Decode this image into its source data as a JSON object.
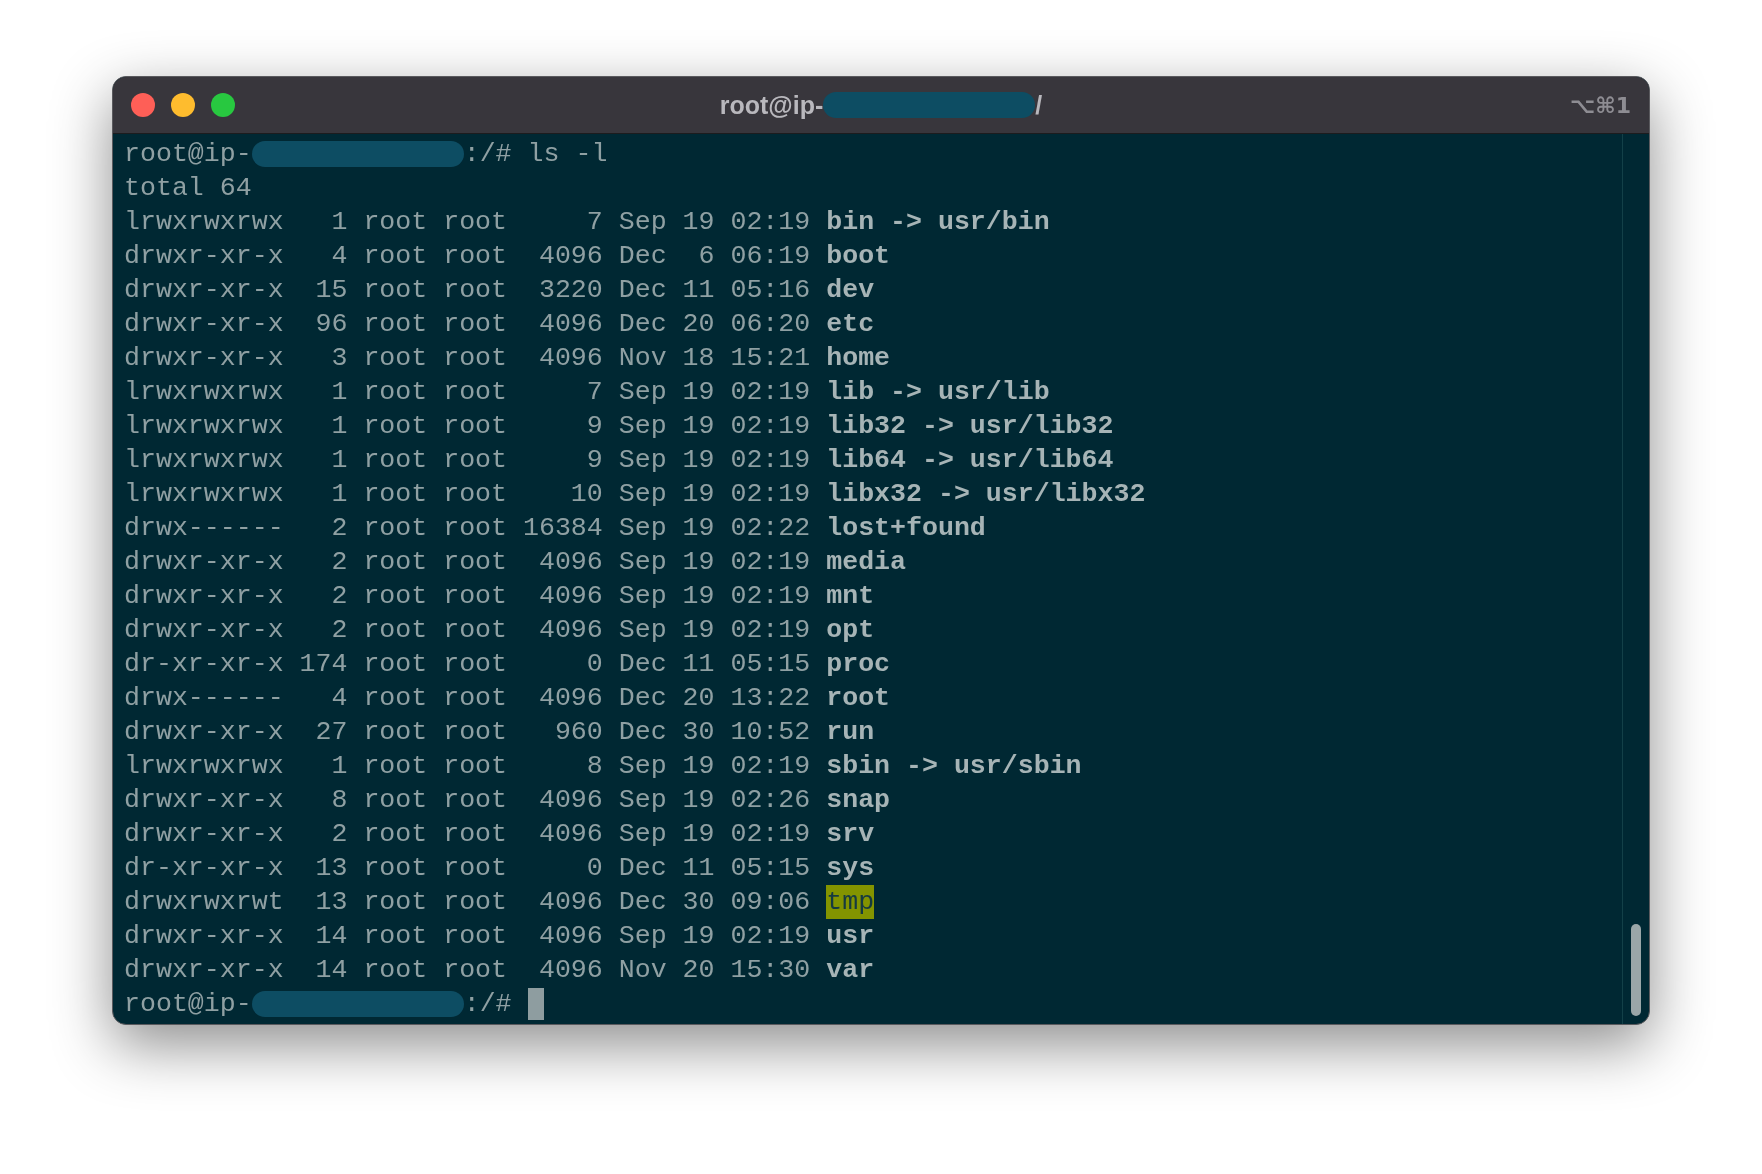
{
  "window": {
    "title_prefix": "root@ip-",
    "title_redacted": true,
    "title_suffix": "/",
    "shortcut": "⌥⌘1"
  },
  "command_prompt": {
    "prefix": "root@ip-",
    "redacted": true,
    "suffix": ":/#",
    "command": "ls -l"
  },
  "total": "total 64",
  "rows": [
    {
      "info": "lrwxrwxrwx   1 root root     7 Sep 19 02:19",
      "name": "bin -> usr/bin",
      "highlighted": false
    },
    {
      "info": "drwxr-xr-x   4 root root  4096 Dec  6 06:19",
      "name": "boot",
      "highlighted": false
    },
    {
      "info": "drwxr-xr-x  15 root root  3220 Dec 11 05:16",
      "name": "dev",
      "highlighted": false
    },
    {
      "info": "drwxr-xr-x  96 root root  4096 Dec 20 06:20",
      "name": "etc",
      "highlighted": false
    },
    {
      "info": "drwxr-xr-x   3 root root  4096 Nov 18 15:21",
      "name": "home",
      "highlighted": false
    },
    {
      "info": "lrwxrwxrwx   1 root root     7 Sep 19 02:19",
      "name": "lib -> usr/lib",
      "highlighted": false
    },
    {
      "info": "lrwxrwxrwx   1 root root     9 Sep 19 02:19",
      "name": "lib32 -> usr/lib32",
      "highlighted": false
    },
    {
      "info": "lrwxrwxrwx   1 root root     9 Sep 19 02:19",
      "name": "lib64 -> usr/lib64",
      "highlighted": false
    },
    {
      "info": "lrwxrwxrwx   1 root root    10 Sep 19 02:19",
      "name": "libx32 -> usr/libx32",
      "highlighted": false
    },
    {
      "info": "drwx------   2 root root 16384 Sep 19 02:22",
      "name": "lost+found",
      "highlighted": false
    },
    {
      "info": "drwxr-xr-x   2 root root  4096 Sep 19 02:19",
      "name": "media",
      "highlighted": false
    },
    {
      "info": "drwxr-xr-x   2 root root  4096 Sep 19 02:19",
      "name": "mnt",
      "highlighted": false
    },
    {
      "info": "drwxr-xr-x   2 root root  4096 Sep 19 02:19",
      "name": "opt",
      "highlighted": false
    },
    {
      "info": "dr-xr-xr-x 174 root root     0 Dec 11 05:15",
      "name": "proc",
      "highlighted": false
    },
    {
      "info": "drwx------   4 root root  4096 Dec 20 13:22",
      "name": "root",
      "highlighted": false
    },
    {
      "info": "drwxr-xr-x  27 root root   960 Dec 30 10:52",
      "name": "run",
      "highlighted": false
    },
    {
      "info": "lrwxrwxrwx   1 root root     8 Sep 19 02:19",
      "name": "sbin -> usr/sbin",
      "highlighted": false
    },
    {
      "info": "drwxr-xr-x   8 root root  4096 Sep 19 02:26",
      "name": "snap",
      "highlighted": false
    },
    {
      "info": "drwxr-xr-x   2 root root  4096 Sep 19 02:19",
      "name": "srv",
      "highlighted": false
    },
    {
      "info": "dr-xr-xr-x  13 root root     0 Dec 11 05:15",
      "name": "sys",
      "highlighted": false
    },
    {
      "info": "drwxrwxrwt  13 root root  4096 Dec 30 09:06",
      "name": "tmp",
      "highlighted": true
    },
    {
      "info": "drwxr-xr-x  14 root root  4096 Sep 19 02:19",
      "name": "usr",
      "highlighted": false
    },
    {
      "info": "drwxr-xr-x  14 root root  4096 Nov 20 15:30",
      "name": "var",
      "highlighted": false
    }
  ],
  "final_prompt": {
    "prefix": "root@ip-",
    "redacted": true,
    "suffix": ":/#"
  }
}
